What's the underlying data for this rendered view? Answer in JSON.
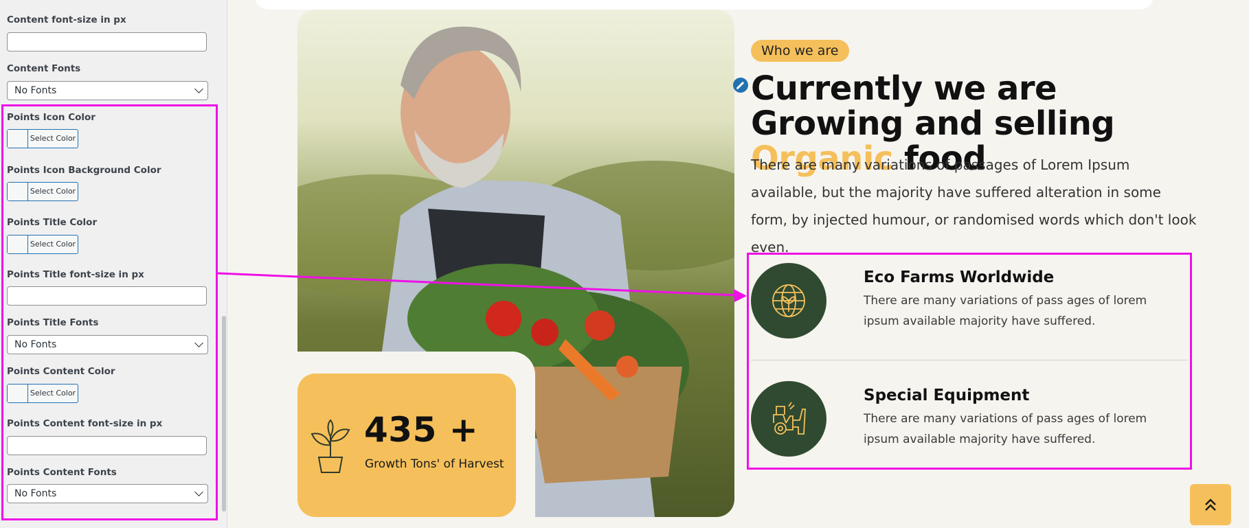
{
  "sidebar": {
    "content_font_size_label": "Content font-size in px",
    "content_font_size_value": "",
    "content_fonts_label": "Content Fonts",
    "content_fonts_value": "No Fonts",
    "points_icon_color_label": "Points Icon Color",
    "points_icon_bg_label": "Points Icon Background Color",
    "points_title_color_label": "Points Title Color",
    "points_title_size_label": "Points Title font-size in px",
    "points_title_size_value": "",
    "points_title_fonts_label": "Points Title Fonts",
    "points_title_fonts_value": "No Fonts",
    "points_content_color_label": "Points Content Color",
    "points_content_size_label": "Points Content font-size in px",
    "points_content_size_value": "",
    "points_content_fonts_label": "Points Content Fonts",
    "points_content_fonts_value": "No Fonts",
    "select_color_label": "Select Color"
  },
  "hero": {
    "badge": "Who we are",
    "headline_part1": "Currently we are Growing and selling ",
    "headline_accent": "Organic",
    "headline_part2": " food",
    "lead": "There are many variations of passages of Lorem Ipsum available, but the majority have suffered alteration in some form, by injected humour, or randomised words which don't look even."
  },
  "stat": {
    "number": "435 +",
    "caption": "Growth Tons' of Harvest"
  },
  "points": [
    {
      "title": "Eco Farms Worldwide",
      "text": "There are many variations of pass ages of lorem ipsum available majority have suffered.",
      "icon": "globe-leaf-icon"
    },
    {
      "title": "Special Equipment",
      "text": "There are many variations of pass ages of lorem ipsum available majority have suffered.",
      "icon": "tractor-icon"
    }
  ],
  "colors": {
    "accent": "#f5c05b",
    "icon_circle": "#2f4a30",
    "highlight": "#ee10e6",
    "wp_blue": "#2271b1"
  },
  "icons": {
    "plant": "plant-pot-icon",
    "edit": "pencil-icon",
    "scroll_top": "double-chevron-up-icon"
  }
}
